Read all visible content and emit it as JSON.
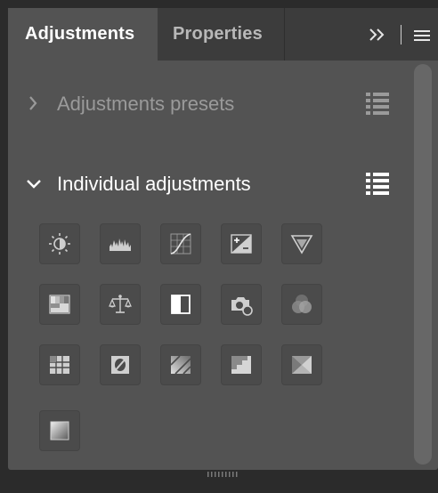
{
  "tabs": [
    {
      "label": "Adjustments",
      "active": true
    },
    {
      "label": "Properties",
      "active": false
    }
  ],
  "tabbar_icons": [
    "double-chevron-right-icon",
    "panel-menu-icon"
  ],
  "sections": {
    "presets": {
      "label": "Adjustments presets",
      "expanded": false
    },
    "individual": {
      "label": "Individual adjustments",
      "expanded": true
    }
  },
  "adjustments": [
    "brightness-contrast-icon",
    "levels-icon",
    "curves-icon",
    "exposure-icon",
    "vibrance-icon",
    "color-balance-icon",
    "hue-saturation-icon",
    "black-white-icon",
    "photo-filter-icon",
    "channel-mixer-icon",
    "color-lookup-icon",
    "invert-icon",
    "posterize-icon",
    "threshold-icon",
    "selective-color-icon",
    "gradient-map-icon"
  ],
  "colors": {
    "panel_bg": "#535353",
    "tab_bar_bg": "#3c3c3c",
    "app_bg": "#2b2b2b",
    "text_primary": "#ffffff",
    "text_dim": "#9a9a9a"
  }
}
